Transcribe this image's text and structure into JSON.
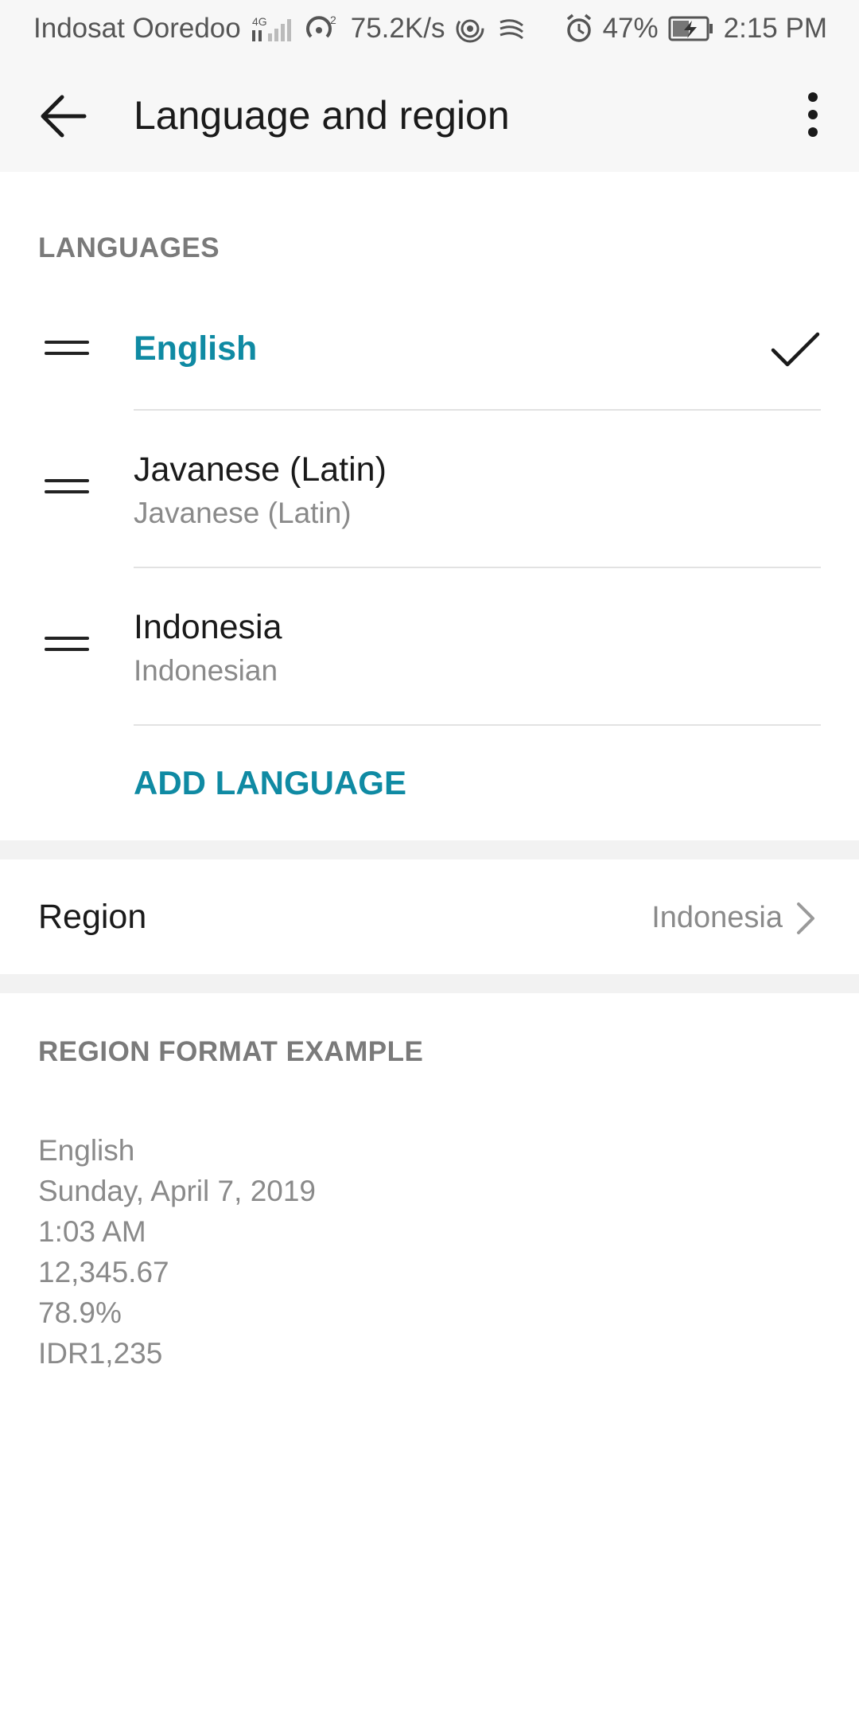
{
  "status_bar": {
    "carrier": "Indosat Ooredoo",
    "network_type": "4G",
    "hotspot_count": "2",
    "speed": "75.2K/s",
    "battery_percent": "47%",
    "time": "2:15 PM",
    "icons": [
      "signal-icon",
      "hotspot-icon",
      "nfc-icon",
      "swiftkey-icon",
      "alarm-icon",
      "battery-charging-icon"
    ]
  },
  "app_bar": {
    "title": "Language and region",
    "back_icon": "back-arrow-icon",
    "menu_icon": "more-vert-icon"
  },
  "languages_section": {
    "header": "LANGUAGES",
    "items": [
      {
        "primary": "English",
        "secondary": "",
        "active": true
      },
      {
        "primary": "Javanese (Latin)",
        "secondary": "Javanese (Latin)",
        "active": false
      },
      {
        "primary": "Indonesia",
        "secondary": "Indonesian",
        "active": false
      }
    ],
    "add_label": "ADD LANGUAGE"
  },
  "region": {
    "label": "Region",
    "value": "Indonesia"
  },
  "format_example": {
    "header": "REGION FORMAT EXAMPLE",
    "lines": [
      "English",
      "Sunday, April 7, 2019",
      "1:03 AM",
      "12,345.67",
      "78.9%",
      "IDR1,235"
    ]
  },
  "colors": {
    "accent": "#0f8aa3",
    "bar_background": "#f7f7f7",
    "secondary_text": "#8a8a8a"
  }
}
